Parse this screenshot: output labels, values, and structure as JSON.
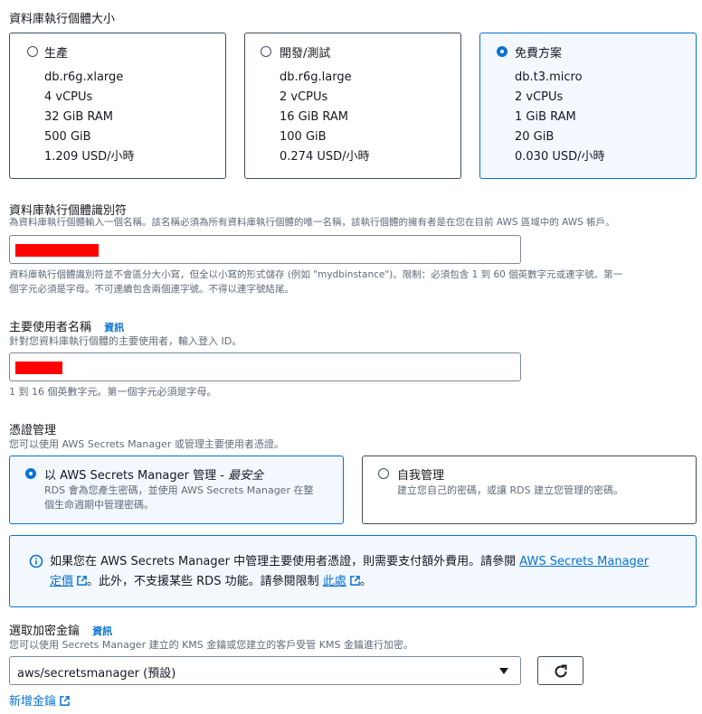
{
  "instance_size": {
    "heading": "資料庫執行個體大小",
    "options": [
      {
        "label": "生產",
        "specs": [
          "db.r6g.xlarge",
          "4 vCPUs",
          "32 GiB RAM",
          "500 GiB",
          "1.209 USD/小時"
        ],
        "selected": false
      },
      {
        "label": "開發/測試",
        "specs": [
          "db.r6g.large",
          "2 vCPUs",
          "16 GiB RAM",
          "100 GiB",
          "0.274 USD/小時"
        ],
        "selected": false
      },
      {
        "label": "免費方案",
        "specs": [
          "db.t3.micro",
          "2 vCPUs",
          "1 GiB RAM",
          "20 GiB",
          "0.030 USD/小時"
        ],
        "selected": true
      }
    ]
  },
  "identifier": {
    "label": "資料庫執行個體識別符",
    "description": "為資料庫執行個體輸入一個名稱。該名稱必須為所有資料庫執行個體的唯一名稱，該執行個體的擁有者是在您在目前 AWS 區域中的 AWS 帳戶。",
    "constraint_line1": "資料庫執行個體識別符並不會區分大小寫，但全以小寫的形式儲存 (例如 \"mydbinstance\")。限制：必須包含 1 到 60 個英數字元或連字號。第一",
    "constraint_line2": "個字元必須是字母。不可連續包含兩個連字號。不得以連字號結尾。"
  },
  "master_user": {
    "label": "主要使用者名稱",
    "info": "資訊",
    "description": "針對您資料庫執行個體的主要使用者，輸入登入 ID。",
    "constraint": "1 到 16 個英數字元。第一個字元必須是字母。"
  },
  "credentials": {
    "label": "憑證管理",
    "description": "您可以使用 AWS Secrets Manager 或管理主要使用者憑證。",
    "options": [
      {
        "title": "以 AWS Secrets Manager 管理 - ",
        "title_em": "最安全",
        "desc_line1": "RDS 會為您產生密碼，並使用 AWS Secrets Manager 在整",
        "desc_line2": "個生命週期中管理密碼。",
        "selected": true
      },
      {
        "title": "自我管理",
        "title_em": "",
        "desc_line1": "建立您自己的密碼，或讓 RDS 建立您管理的密碼。",
        "desc_line2": "",
        "selected": false
      }
    ]
  },
  "notice": {
    "text1": "如果您在 AWS Secrets Manager 中管理主要使用者憑證，則需要支付額外費用。請參閱",
    "link1a": "AWS Secrets Manager",
    "link1b": "定價",
    "text2": "。此外，不支援某些 RDS 功能。請參閱限制",
    "link2": "此處",
    "text3": "。"
  },
  "kms": {
    "label": "選取加密金鑰",
    "info": "資訊",
    "description": "您可以使用 Secrets Manager 建立的 KMS 金鑰或您建立的客戶受管 KMS 金鑰進行加密。",
    "selected": "aws/secretsmanager (預設)",
    "new_key": "新增金鑰"
  },
  "colors": {
    "accent": "#0972d3",
    "info_bg": "#f2f8fd",
    "redaction": "#ff0000"
  }
}
